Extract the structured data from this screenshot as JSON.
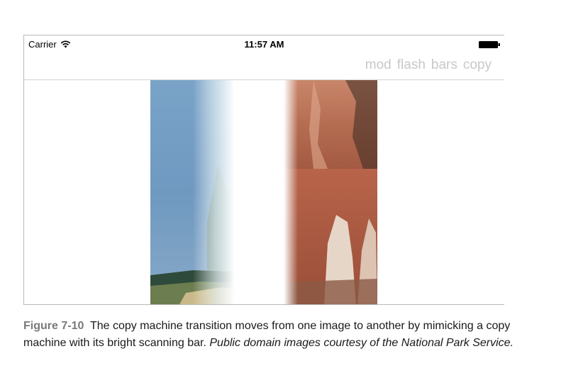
{
  "status_bar": {
    "carrier": "Carrier",
    "time": "11:57 AM",
    "wifi_icon": "wifi-icon",
    "battery_icon": "battery-icon"
  },
  "nav": {
    "buttons": [
      "mod",
      "flash",
      "bars",
      "copy"
    ],
    "button_color": "#c8c8c8"
  },
  "content": {
    "image": "copy machine transition between two national park photos"
  },
  "caption": {
    "label": "Figure 7-10",
    "text": "The copy machine transition moves from one image to another by mimicking a copy machine with its bright scanning bar.",
    "italic_text": "Public domain images courtesy of the National Park Service."
  }
}
